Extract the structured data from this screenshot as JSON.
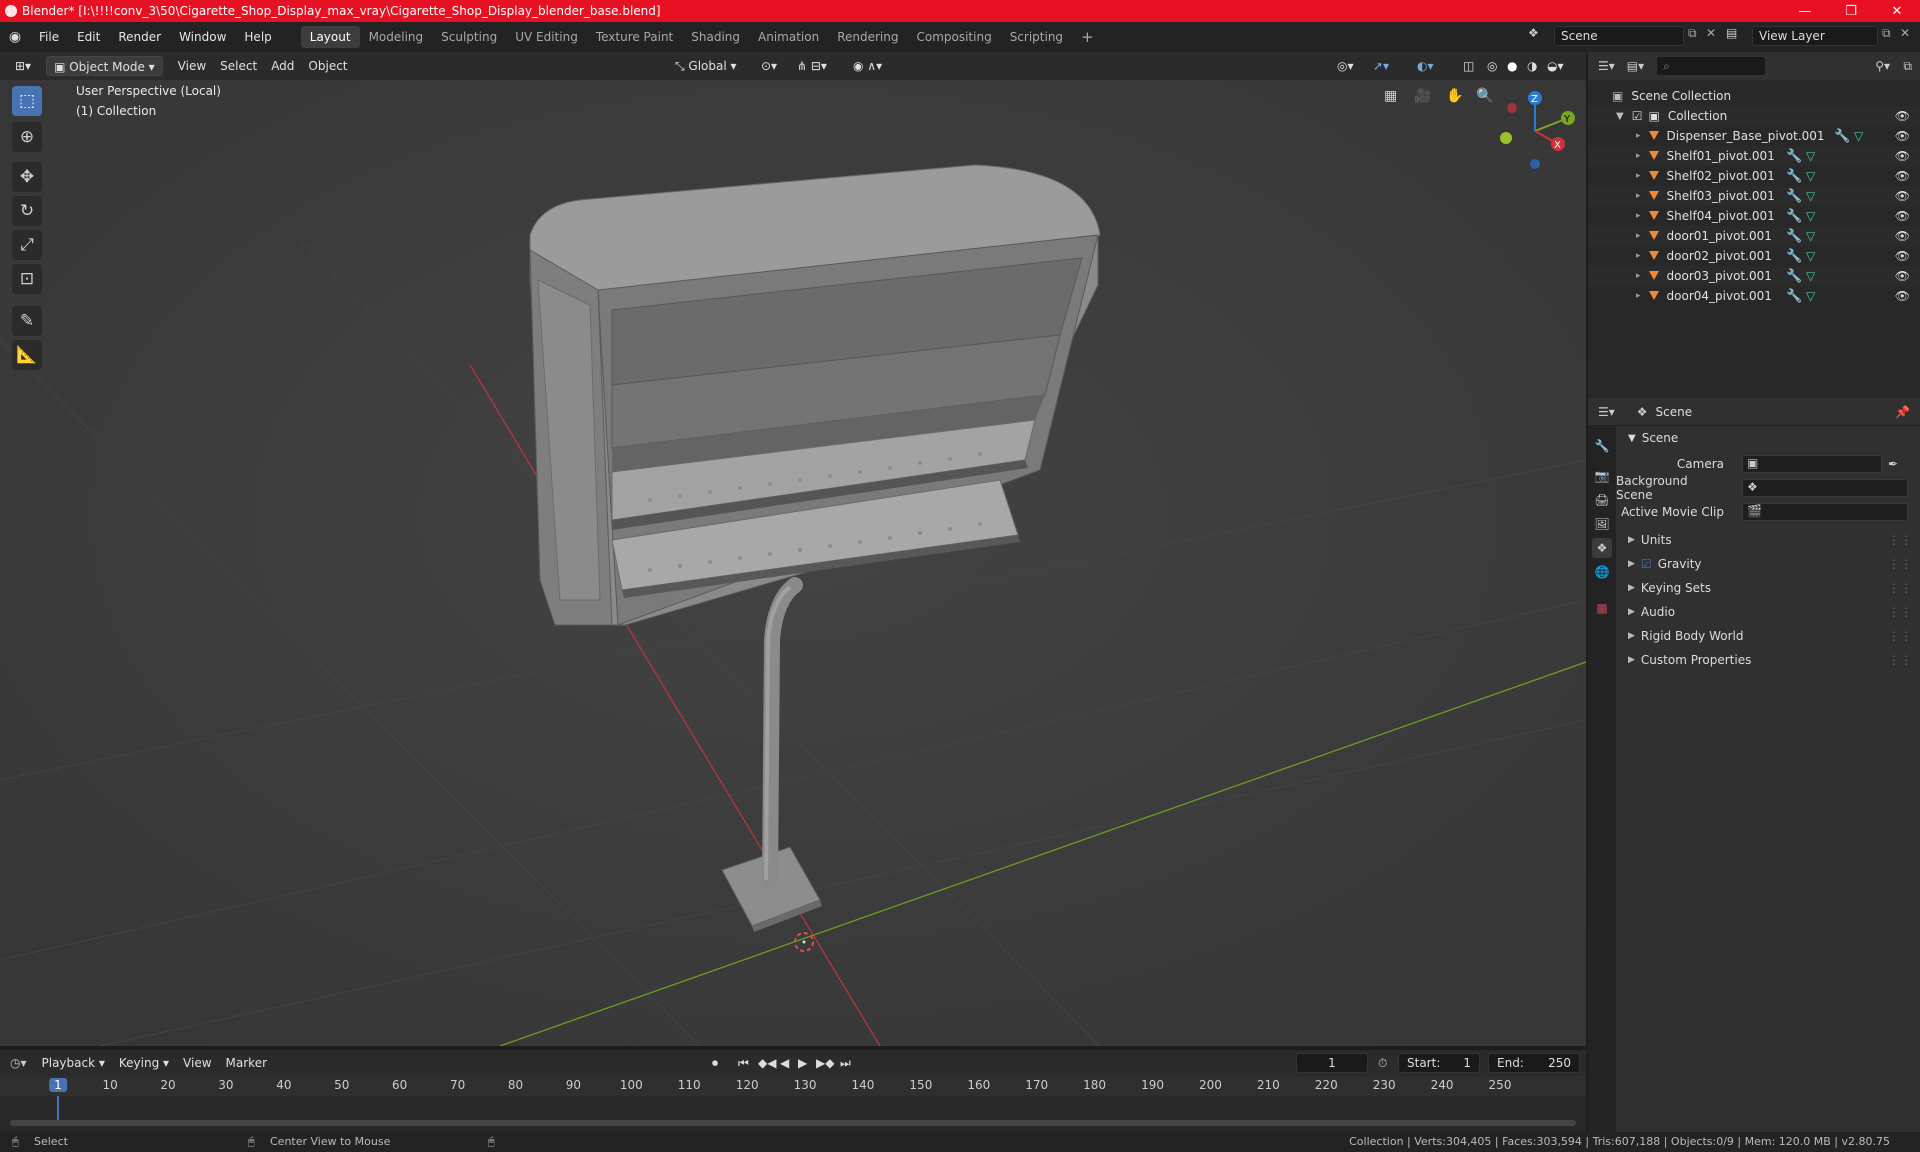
{
  "window": {
    "title": "Blender* [I:\\!!!!conv_3\\50\\Cigarette_Shop_Display_max_vray\\Cigarette_Shop_Display_blender_base.blend]",
    "minimize": "—",
    "maximize": "❐",
    "close": "✕"
  },
  "menu": [
    "File",
    "Edit",
    "Render",
    "Window",
    "Help"
  ],
  "workspaces": [
    "Layout",
    "Modeling",
    "Sculpting",
    "UV Editing",
    "Texture Paint",
    "Shading",
    "Animation",
    "Rendering",
    "Compositing",
    "Scripting"
  ],
  "add_tab": "+",
  "scene_field": "Scene",
  "viewlayer_field": "View Layer",
  "viewport": {
    "mode": "Object Mode",
    "menus": [
      "View",
      "Select",
      "Add",
      "Object"
    ],
    "transform": "Global",
    "overlay_line1": "User Perspective (Local)",
    "overlay_line2": "(1) Collection",
    "gizmo": {
      "z": "Z",
      "y": "Y",
      "x": "X"
    }
  },
  "outliner": {
    "root": "Scene Collection",
    "collection": "Collection",
    "items": [
      "Dispenser_Base_pivot.001",
      "Shelf01_pivot.001",
      "Shelf02_pivot.001",
      "Shelf03_pivot.001",
      "Shelf04_pivot.001",
      "door01_pivot.001",
      "door02_pivot.001",
      "door03_pivot.001",
      "door04_pivot.001"
    ]
  },
  "properties": {
    "header": "Scene",
    "panel": "Scene",
    "camera_label": "Camera",
    "bg_scene_label": "Background Scene",
    "movie_clip_label": "Active Movie Clip",
    "sections": [
      "Units",
      "Gravity",
      "Keying Sets",
      "Audio",
      "Rigid Body World",
      "Custom Properties"
    ]
  },
  "timeline": {
    "menus": [
      "Playback",
      "Keying",
      "View",
      "Marker"
    ],
    "current_frame": "1",
    "start_label": "Start:",
    "start": "1",
    "end_label": "End:",
    "end": "250",
    "ticks": [
      "1",
      "10",
      "20",
      "30",
      "40",
      "50",
      "60",
      "70",
      "80",
      "90",
      "100",
      "110",
      "120",
      "130",
      "140",
      "150",
      "160",
      "170",
      "180",
      "190",
      "200",
      "210",
      "220",
      "230",
      "240",
      "250"
    ]
  },
  "status": {
    "select": "Select",
    "center": "Center View to Mouse",
    "stats": "Collection | Verts:304,405 | Faces:303,594 | Tris:607,188 | Objects:0/9 | Mem: 120.0 MB | v2.80.75"
  },
  "colors": {
    "titlebar": "#e81123",
    "accent": "#4772b3",
    "x_axis": "#b5353e",
    "y_axis": "#6e9b22"
  }
}
